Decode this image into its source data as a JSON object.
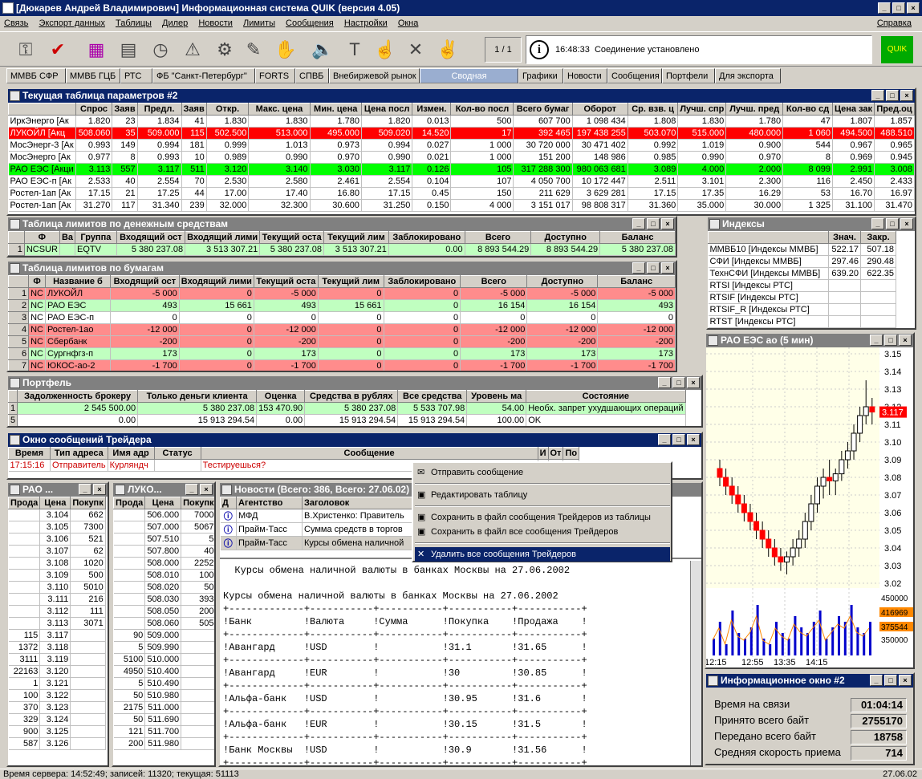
{
  "app": {
    "title": "[Дюкарев Андрей Владимирович] Информационная система QUIK (версия 4.05)"
  },
  "menu": {
    "items": [
      "Связь",
      "Экспорт данных",
      "Таблицы",
      "Дилер",
      "Новости",
      "Лимиты",
      "Сообщения",
      "Настройки",
      "Окна"
    ],
    "help": "Справка"
  },
  "toolbar": {
    "page": "1 / 1",
    "status_time": "16:48:33",
    "status_text": "Соединение установлено"
  },
  "tabs": [
    {
      "label": "ММВБ СФР"
    },
    {
      "label": "ММВБ ГЦБ"
    },
    {
      "label": "РТС"
    },
    {
      "label": "ФБ \"Санкт-Петербург\""
    },
    {
      "label": "FORTS"
    },
    {
      "label": "СПВБ"
    },
    {
      "label": "Внебиржевой рынок"
    },
    {
      "label": "Сводная"
    },
    {
      "label": "Графики"
    },
    {
      "label": "Новости"
    },
    {
      "label": "Сообщения"
    },
    {
      "label": "Портфели"
    },
    {
      "label": "Для экспорта"
    }
  ],
  "params": {
    "title": "Текущая таблица параметров #2",
    "headers": [
      "",
      "Спрос",
      "Заяв",
      "Предл.",
      "Заяв",
      "Откр.",
      "Макс. цена",
      "Мин. цена",
      "Цена посл",
      "Измен.",
      "Кол-во посл",
      "Всего бумаг",
      "Оборот",
      "Ср. взв. ц",
      "Лучш. спр",
      "Лучш. пред",
      "Кол-во сд",
      "Цена зак",
      "Пред.оц"
    ],
    "rows": [
      {
        "style": "",
        "cells": [
          "ИркЭнерго [Ак",
          "1.820",
          "23",
          "1.834",
          "41",
          "1.830",
          "1.830",
          "1.780",
          "1.820",
          "0.013",
          "500",
          "607 700",
          "1 098 434",
          "1.808",
          "1.830",
          "1.780",
          "47",
          "1.807",
          "1.857"
        ]
      },
      {
        "style": "red",
        "cells": [
          "ЛУКОЙЛ [Акц",
          "508.060",
          "35",
          "509.000",
          "115",
          "502.500",
          "513.000",
          "495.000",
          "509.020",
          "14.520",
          "17",
          "392 465",
          "197 438 255",
          "503.070",
          "515.000",
          "480.000",
          "1 060",
          "494.500",
          "488.510"
        ]
      },
      {
        "style": "",
        "cells": [
          "МосЭнерг-3 [Ак",
          "0.993",
          "149",
          "0.994",
          "181",
          "0.999",
          "1.013",
          "0.973",
          "0.994",
          "0.027",
          "1 000",
          "30 720 000",
          "30 471 402",
          "0.992",
          "1.019",
          "0.900",
          "544",
          "0.967",
          "0.965"
        ]
      },
      {
        "style": "",
        "cells": [
          "МосЭнерго [Ак",
          "0.977",
          "8",
          "0.993",
          "10",
          "0.989",
          "0.990",
          "0.970",
          "0.990",
          "0.021",
          "1 000",
          "151 200",
          "148 986",
          "0.985",
          "0.990",
          "0.970",
          "8",
          "0.969",
          "0.945"
        ]
      },
      {
        "style": "grn",
        "cells": [
          "РАО ЕЭС [Акци",
          "3.113",
          "557",
          "3.117",
          "511",
          "3.120",
          "3.140",
          "3.030",
          "3.117",
          "0.126",
          "105",
          "317 288 300",
          "980 063 681",
          "3.089",
          "4.000",
          "2.000",
          "8 099",
          "2.991",
          "3.008"
        ]
      },
      {
        "style": "",
        "cells": [
          "РАО ЕЭС-п [Ак",
          "2.533",
          "40",
          "2.554",
          "70",
          "2.530",
          "2.580",
          "2.461",
          "2.554",
          "0.104",
          "107",
          "4 050 700",
          "10 172 447",
          "2.511",
          "3.101",
          "2.300",
          "116",
          "2.450",
          "2.433"
        ]
      },
      {
        "style": "",
        "cells": [
          "Ростел-1ап [Ак",
          "17.15",
          "21",
          "17.25",
          "44",
          "17.00",
          "17.40",
          "16.80",
          "17.15",
          "0.45",
          "150",
          "211 629",
          "3 629 281",
          "17.15",
          "17.35",
          "16.29",
          "53",
          "16.70",
          "16.97"
        ]
      },
      {
        "style": "",
        "cells": [
          "Ростел-1ап [Ак",
          "31.270",
          "117",
          "31.340",
          "239",
          "32.000",
          "32.300",
          "30.600",
          "31.250",
          "0.150",
          "4 000",
          "3 151 017",
          "98 808 317",
          "31.360",
          "35.000",
          "30.000",
          "1 325",
          "31.100",
          "31.470"
        ]
      }
    ]
  },
  "money": {
    "title": "Таблица лимитов по денежным средствам",
    "headers": [
      "",
      "Ф",
      "Ва",
      "Группа",
      "Входящий ост",
      "Входящий лими",
      "Текущий оста",
      "Текущий лим",
      "Заблокировано",
      "Всего",
      "Доступно",
      "Баланс"
    ],
    "rows": [
      {
        "style": "lgrn",
        "cells": [
          "1",
          "NCSUR",
          "",
          "EQTV",
          "5 380 237.08",
          "3 513 307.21",
          "5 380 237.08",
          "3 513 307.21",
          "0.00",
          "8 893 544.29",
          "8 893 544.29",
          "5 380 237.08"
        ]
      }
    ]
  },
  "secs": {
    "title": "Таблица лимитов по бумагам",
    "headers": [
      "",
      "Ф",
      "Название б",
      "Входящий ост",
      "Входящий лими",
      "Текущий оста",
      "Текущий лим",
      "Заблокировано",
      "Всего",
      "Доступно",
      "Баланс"
    ],
    "rows": [
      {
        "style": "pink",
        "cells": [
          "1",
          "NC",
          "ЛУКОЙЛ",
          "-5 000",
          "0",
          "-5 000",
          "0",
          "0",
          "-5 000",
          "-5 000",
          "-5 000"
        ]
      },
      {
        "style": "lgrn",
        "cells": [
          "2",
          "NC",
          "РАО ЕЭС",
          "493",
          "15 661",
          "493",
          "15 661",
          "0",
          "16 154",
          "16 154",
          "493"
        ]
      },
      {
        "style": "",
        "cells": [
          "3",
          "NC",
          "РАО ЕЭС-п",
          "0",
          "0",
          "0",
          "0",
          "0",
          "0",
          "0",
          "0"
        ]
      },
      {
        "style": "pink",
        "cells": [
          "4",
          "NC",
          "Ростел-1ао",
          "-12 000",
          "0",
          "-12 000",
          "0",
          "0",
          "-12 000",
          "-12 000",
          "-12 000"
        ]
      },
      {
        "style": "pink",
        "cells": [
          "5",
          "NC",
          "Сбербанк",
          "-200",
          "0",
          "-200",
          "0",
          "0",
          "-200",
          "-200",
          "-200"
        ]
      },
      {
        "style": "lgrn",
        "cells": [
          "6",
          "NC",
          "Сургнфгз-п",
          "173",
          "0",
          "173",
          "0",
          "0",
          "173",
          "173",
          "173"
        ]
      },
      {
        "style": "pink",
        "cells": [
          "7",
          "NC",
          "ЮКОС-ао-2",
          "-1 700",
          "0",
          "-1 700",
          "0",
          "0",
          "-1 700",
          "-1 700",
          "-1 700"
        ]
      }
    ]
  },
  "portfolio": {
    "title": "Портфель",
    "headers": [
      "",
      "Задолженность брокеру",
      "Только деньги клиента",
      "Оценка",
      "Средства в рублях",
      "Все средства",
      "Уровень ма",
      "Состояние"
    ],
    "rows": [
      {
        "style": "lgrn",
        "cells": [
          "1",
          "2 545 500.00",
          "5 380 237.08",
          "153 470.90",
          "5 380 237.08",
          "5 533 707.98",
          "54.00",
          "Необх. запрет ухудшающих операций"
        ]
      },
      {
        "style": "",
        "cells": [
          "5",
          "0.00",
          "15 913 294.54",
          "0.00",
          "15 913 294.54",
          "15 913 294.54",
          "100.00",
          "OK"
        ]
      }
    ]
  },
  "indices": {
    "title": "Индексы",
    "headers": [
      "",
      "Знач.",
      "Закр."
    ],
    "rows": [
      [
        "ММВБ10 [Индексы ММВБ]",
        "522.17",
        "507.18"
      ],
      [
        "СФИ [Индексы ММВБ]",
        "297.46",
        "290.48"
      ],
      [
        "ТехнСФИ [Индексы ММВБ]",
        "639.20",
        "622.35"
      ],
      [
        "RTSI [Индексы РТС]",
        "",
        ""
      ],
      [
        "RTSIF [Индексы РТС]",
        "",
        ""
      ],
      [
        "RTSIF_R [Индексы РТС]",
        "",
        ""
      ],
      [
        "RTST [Индексы РТС]",
        "",
        ""
      ]
    ]
  },
  "messages": {
    "title": "Окно сообщений Трейдера",
    "headers": [
      "Время",
      "Тип адреса",
      "Имя адр",
      "Статус",
      "Сообщение",
      "И",
      "От",
      "По"
    ],
    "row": [
      "17:15:16",
      "Отправитель",
      "Курляндч",
      "",
      "Тестируешься?"
    ]
  },
  "context_menu": [
    {
      "label": "Отправить сообщение",
      "icon": "envelope-icon"
    },
    {
      "label": "Редактировать таблицу",
      "icon": "edit-table-icon"
    },
    {
      "label": "Сохранить в файл сообщения Трейдеров из таблицы",
      "icon": "save-icon"
    },
    {
      "label": "Сохранить в файл все сообщения Трейдеров",
      "icon": "save-all-icon"
    },
    {
      "label": "Удалить все сообщения Трейдеров",
      "icon": "delete-icon"
    }
  ],
  "orderbook1": {
    "title": "РАО ...",
    "headers": [
      "Прода",
      "Цена",
      "Покупк"
    ],
    "rows": [
      [
        "",
        "3.104",
        "662"
      ],
      [
        "",
        "3.105",
        "7300"
      ],
      [
        "",
        "3.106",
        "521"
      ],
      [
        "",
        "3.107",
        "62"
      ],
      [
        "",
        "3.108",
        "1020"
      ],
      [
        "",
        "3.109",
        "500"
      ],
      [
        "",
        "3.110",
        "5010"
      ],
      [
        "",
        "3.111",
        "216"
      ],
      [
        "",
        "3.112",
        "111"
      ],
      [
        "",
        "3.113",
        "3071"
      ],
      [
        "115",
        "3.117",
        ""
      ],
      [
        "1372",
        "3.118",
        ""
      ],
      [
        "3111",
        "3.119",
        ""
      ],
      [
        "22163",
        "3.120",
        ""
      ],
      [
        "1",
        "3.121",
        ""
      ],
      [
        "100",
        "3.122",
        ""
      ],
      [
        "370",
        "3.123",
        ""
      ],
      [
        "329",
        "3.124",
        ""
      ],
      [
        "900",
        "3.125",
        ""
      ],
      [
        "587",
        "3.126",
        ""
      ]
    ]
  },
  "orderbook2": {
    "title": "ЛУКО...",
    "headers": [
      "Прода",
      "Цена",
      "Покупк"
    ],
    "rows": [
      [
        "",
        "506.000",
        "7000"
      ],
      [
        "",
        "507.000",
        "5067"
      ],
      [
        "",
        "507.510",
        "5"
      ],
      [
        "",
        "507.800",
        "40"
      ],
      [
        "",
        "508.000",
        "2252"
      ],
      [
        "",
        "508.010",
        "100"
      ],
      [
        "",
        "508.020",
        "50"
      ],
      [
        "",
        "508.030",
        "393"
      ],
      [
        "",
        "508.050",
        "200"
      ],
      [
        "",
        "508.060",
        "505"
      ],
      [
        "90",
        "509.000",
        ""
      ],
      [
        "5",
        "509.990",
        ""
      ],
      [
        "5100",
        "510.000",
        ""
      ],
      [
        "4950",
        "510.400",
        ""
      ],
      [
        "5",
        "510.490",
        ""
      ],
      [
        "50",
        "510.980",
        ""
      ],
      [
        "2175",
        "511.000",
        ""
      ],
      [
        "50",
        "511.690",
        ""
      ],
      [
        "121",
        "511.700",
        ""
      ],
      [
        "200",
        "511.980",
        ""
      ]
    ]
  },
  "news": {
    "title": "Новости (Всего: 386, Всего: 27.06.02)",
    "headers": [
      "Д",
      "Агентство",
      "Заголовок"
    ],
    "rows": [
      [
        "МФД",
        "В.Христенко: Правитель"
      ],
      [
        "Прайм-Тасс",
        "Сумма средств в торгов"
      ],
      [
        "Прайм-Тасс",
        "Курсы обмена наличной"
      ]
    ],
    "body": "  Курсы обмена наличной валюты в банках Москвы на 27.06.2002\n\nКурсы обмена наличной валюты в банках Москвы на 27.06.2002\n+-------------+-----------+-----------+-----------+-----------+\n!Банк         !Валюта     !Сумма      !Покупка    !Продажа    !\n+-------------+-----------+-----------+-----------+-----------+\n!Авангард     !USD        !           !31.1       !31.65      !\n+-------------+-----------+-----------+-----------+-----------+\n!Авангард     !EUR        !           !30         !30.85      !\n+-------------+-----------+-----------+-----------+-----------+\n!Альфа-банк   !USD        !           !30.95      !31.6       !\n+-------------+-----------+-----------+-----------+-----------+\n!Альфа-банк   !EUR        !           !30.15      !31.5       !\n+-------------+-----------+-----------+-----------+-----------+\n!Банк Москвы  !USD        !           !30.9       !31.56      !\n+-------------+-----------+-----------+-----------+-----------+"
  },
  "chart": {
    "title": "РАО ЕЭС ао (5 мин)",
    "last_price": "3.117",
    "vol_labels": [
      "450000",
      "416969",
      "375544",
      "350000"
    ],
    "time_labels": [
      "12:15",
      "12:55",
      "13:35",
      "14:15"
    ]
  },
  "chart_data": {
    "type": "candlestick",
    "ylim": [
      3.02,
      3.15
    ],
    "yticks": [
      "3.15",
      "3.14",
      "3.13",
      "3.12",
      "3.11",
      "3.10",
      "3.09",
      "3.08",
      "3.07",
      "3.06",
      "3.05",
      "3.04",
      "3.03",
      "3.02"
    ],
    "ohlc": [
      [
        3.085,
        3.09,
        3.075,
        3.08
      ],
      [
        3.08,
        3.085,
        3.07,
        3.075
      ],
      [
        3.075,
        3.08,
        3.065,
        3.07
      ],
      [
        3.07,
        3.075,
        3.06,
        3.065
      ],
      [
        3.065,
        3.07,
        3.055,
        3.06
      ],
      [
        3.06,
        3.065,
        3.05,
        3.055
      ],
      [
        3.055,
        3.06,
        3.045,
        3.05
      ],
      [
        3.05,
        3.055,
        3.04,
        3.045
      ],
      [
        3.045,
        3.05,
        3.035,
        3.04
      ],
      [
        3.04,
        3.045,
        3.03,
        3.035
      ],
      [
        3.035,
        3.04,
        3.027,
        3.032
      ],
      [
        3.032,
        3.038,
        3.025,
        3.035
      ],
      [
        3.035,
        3.045,
        3.03,
        3.04
      ],
      [
        3.04,
        3.05,
        3.035,
        3.045
      ],
      [
        3.045,
        3.06,
        3.04,
        3.055
      ],
      [
        3.055,
        3.07,
        3.05,
        3.065
      ],
      [
        3.065,
        3.08,
        3.06,
        3.075
      ],
      [
        3.075,
        3.085,
        3.068,
        3.08
      ],
      [
        3.08,
        3.09,
        3.07,
        3.078
      ],
      [
        3.078,
        3.085,
        3.07,
        3.082
      ],
      [
        3.082,
        3.095,
        3.078,
        3.09
      ],
      [
        3.09,
        3.1,
        3.085,
        3.095
      ],
      [
        3.095,
        3.11,
        3.09,
        3.105
      ],
      [
        3.105,
        3.12,
        3.1,
        3.115
      ],
      [
        3.115,
        3.135,
        3.11,
        3.12
      ],
      [
        3.12,
        3.125,
        3.11,
        3.117
      ]
    ],
    "volumes": [
      0.3,
      0.6,
      0.2,
      0.8,
      0.4,
      0.3,
      0.5,
      0.9,
      0.3,
      0.2,
      0.6,
      0.4,
      0.3,
      0.7,
      0.5,
      0.4,
      0.6,
      0.8,
      0.3,
      0.5,
      0.7,
      0.6,
      0.9,
      0.5,
      0.4,
      0.6
    ]
  },
  "info": {
    "title": "Информационное окно #2",
    "rows": [
      {
        "label": "Время на связи",
        "value": "01:04:14"
      },
      {
        "label": "Принято всего байт",
        "value": "2755170"
      },
      {
        "label": "Передано всего байт",
        "value": "18758"
      },
      {
        "label": "Средняя скорость приема",
        "value": "714"
      }
    ]
  },
  "statusbar": {
    "left": "Время сервера: 14:52:49; записей: 11320; текущая: 51113",
    "right": "27.06.02"
  }
}
